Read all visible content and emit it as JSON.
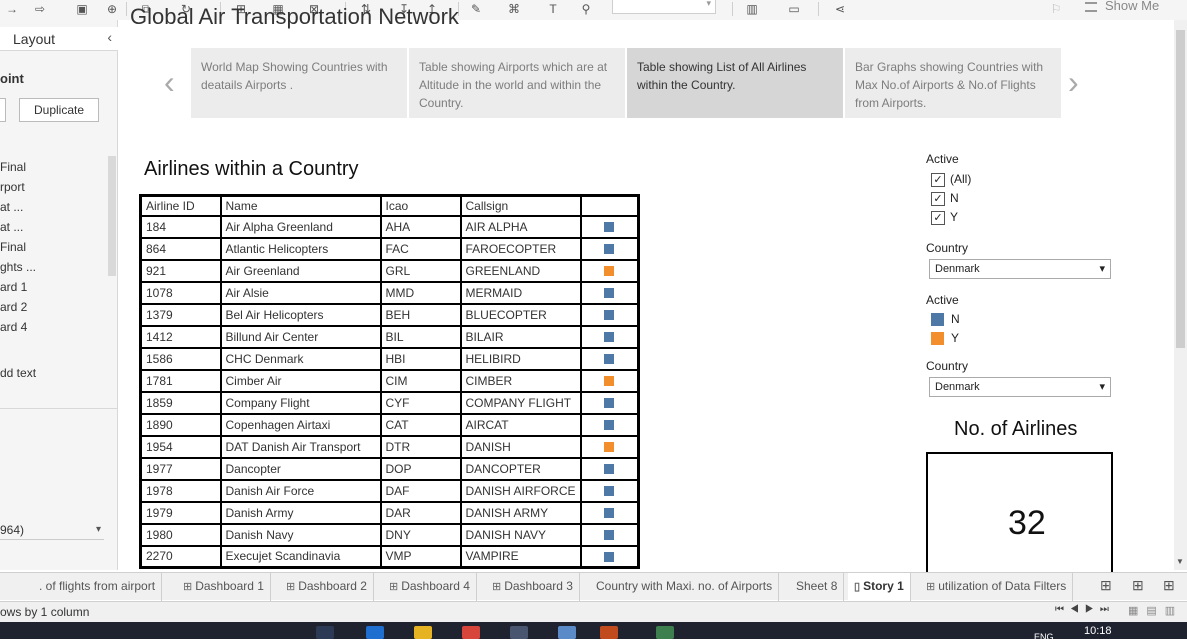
{
  "toolbar": {
    "show_me": "Show Me"
  },
  "left_pane": {
    "tab_label": "Layout",
    "section_label": "oint",
    "duplicate_label": "Duplicate",
    "sheets": [
      "Final",
      "rport",
      "at ...",
      "at ...",
      "Final",
      "ghts ...",
      "ard 1",
      "ard 2",
      "ard 4"
    ],
    "add_text": "dd text",
    "selector_value": "964)"
  },
  "story": {
    "title": "Global Air Transportation Network",
    "points": [
      {
        "text": "World Map Showing Countries with deatails Airports ."
      },
      {
        "text": "Table showing Airports which are at Altitude in the world and within the Country."
      },
      {
        "text": "Table showing List of All Airlines within the Country."
      },
      {
        "text": "Bar Graphs showing Countries with Max No.of Airports & No.of Flights from Airports."
      }
    ]
  },
  "sheet_title": "Airlines within a Country",
  "table": {
    "headers": [
      "Airline ID",
      "Name",
      "Icao",
      "Callsign",
      ""
    ],
    "rows": [
      {
        "id": "184",
        "name": "Air Alpha Greenland",
        "icao": "AHA",
        "callsign": "AIR ALPHA",
        "active": "N"
      },
      {
        "id": "864",
        "name": "Atlantic Helicopters",
        "icao": "FAC",
        "callsign": "FAROECOPTER",
        "active": "N"
      },
      {
        "id": "921",
        "name": "Air Greenland",
        "icao": "GRL",
        "callsign": "GREENLAND",
        "active": "Y"
      },
      {
        "id": "1078",
        "name": "Air Alsie",
        "icao": "MMD",
        "callsign": "MERMAID",
        "active": "N"
      },
      {
        "id": "1379",
        "name": "Bel Air Helicopters",
        "icao": "BEH",
        "callsign": "BLUECOPTER",
        "active": "N"
      },
      {
        "id": "1412",
        "name": "Billund Air Center",
        "icao": "BIL",
        "callsign": "BILAIR",
        "active": "N"
      },
      {
        "id": "1586",
        "name": "CHC Denmark",
        "icao": "HBI",
        "callsign": "HELIBIRD",
        "active": "N"
      },
      {
        "id": "1781",
        "name": "Cimber Air",
        "icao": "CIM",
        "callsign": "CIMBER",
        "active": "Y"
      },
      {
        "id": "1859",
        "name": "Company Flight",
        "icao": "CYF",
        "callsign": "COMPANY FLIGHT",
        "active": "N"
      },
      {
        "id": "1890",
        "name": "Copenhagen Airtaxi",
        "icao": "CAT",
        "callsign": "AIRCAT",
        "active": "N"
      },
      {
        "id": "1954",
        "name": "DAT Danish Air Transport",
        "icao": "DTR",
        "callsign": "DANISH",
        "active": "Y"
      },
      {
        "id": "1977",
        "name": "Dancopter",
        "icao": "DOP",
        "callsign": "DANCOPTER",
        "active": "N"
      },
      {
        "id": "1978",
        "name": "Danish Air Force",
        "icao": "DAF",
        "callsign": "DANISH AIRFORCE",
        "active": "N"
      },
      {
        "id": "1979",
        "name": "Danish Army",
        "icao": "DAR",
        "callsign": "DANISH ARMY",
        "active": "N"
      },
      {
        "id": "1980",
        "name": "Danish Navy",
        "icao": "DNY",
        "callsign": "DANISH NAVY",
        "active": "N"
      },
      {
        "id": "2270",
        "name": "Execujet Scandinavia",
        "icao": "VMP",
        "callsign": "VAMPIRE",
        "active": "N"
      }
    ]
  },
  "colors": {
    "N": "#4e79a7",
    "Y": "#f28e2b"
  },
  "filters": {
    "active_label": "Active",
    "active_options": [
      "(All)",
      "N",
      "Y"
    ],
    "country_label": "Country",
    "country_value": "Denmark",
    "legend_label": "Active",
    "legend_items": [
      "N",
      "Y"
    ],
    "country2_label": "Country",
    "country2_value": "Denmark"
  },
  "kpi": {
    "title": "No. of Airlines",
    "value": "32"
  },
  "tabs": [
    {
      "label": ". of flights from airport",
      "icon": ""
    },
    {
      "label": "Dashboard 1",
      "icon": "⊞"
    },
    {
      "label": "Dashboard 2",
      "icon": "⊞"
    },
    {
      "label": "Dashboard 4",
      "icon": "⊞"
    },
    {
      "label": "Dashboard 3",
      "icon": "⊞"
    },
    {
      "label": "Country with Maxi. no. of Airports",
      "icon": ""
    },
    {
      "label": "Sheet 8",
      "icon": ""
    },
    {
      "label": "Story 1",
      "icon": "▯"
    },
    {
      "label": "utilization of Data Filters",
      "icon": "⊞"
    }
  ],
  "status": {
    "text": "ows by 1 column"
  },
  "clock": {
    "time": "10:18",
    "lang": "ENG"
  }
}
